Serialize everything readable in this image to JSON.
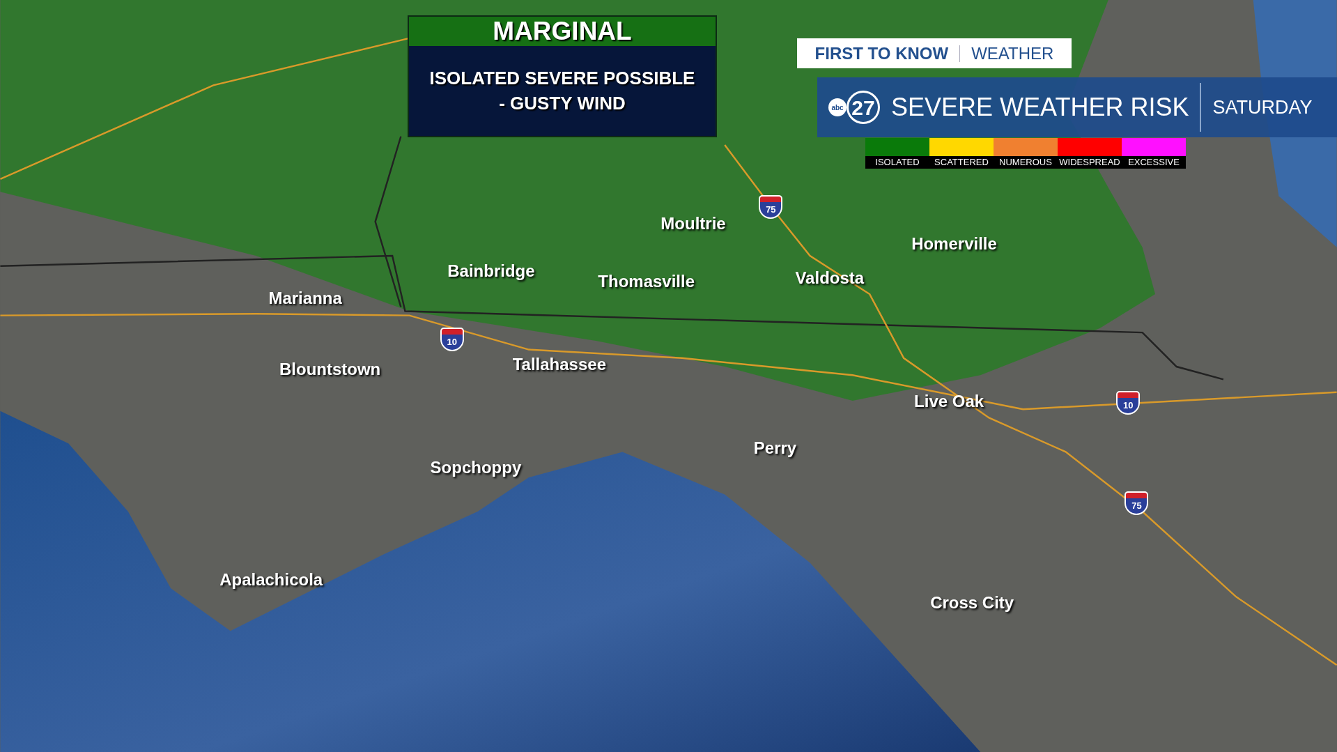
{
  "risk_box": {
    "category": "MARGINAL",
    "description": [
      "ISOLATED SEVERE POSSIBLE",
      "- GUSTY WIND"
    ]
  },
  "header": {
    "tag": [
      "FIRST TO KNOW",
      "WEATHER"
    ],
    "logo": {
      "network": "abc",
      "channel": "27"
    },
    "title": "SEVERE WEATHER RISK",
    "day": "SATURDAY"
  },
  "legend": [
    {
      "label": "ISOLATED",
      "color": "#0a7a0a"
    },
    {
      "label": "SCATTERED",
      "color": "#ffd800"
    },
    {
      "label": "NUMEROUS",
      "color": "#f08030"
    },
    {
      "label": "WIDESPREAD",
      "color": "#ff0000"
    },
    {
      "label": "EXCESSIVE",
      "color": "#ff10ff"
    }
  ],
  "cities": [
    {
      "name": "Moultrie"
    },
    {
      "name": "Homerville"
    },
    {
      "name": "Bainbridge"
    },
    {
      "name": "Thomasville"
    },
    {
      "name": "Valdosta"
    },
    {
      "name": "Marianna"
    },
    {
      "name": "Blountstown"
    },
    {
      "name": "Tallahassee"
    },
    {
      "name": "Live Oak"
    },
    {
      "name": "Perry"
    },
    {
      "name": "Sopchoppy"
    },
    {
      "name": "Apalachicola"
    },
    {
      "name": "Cross City"
    }
  ],
  "shields": [
    {
      "number": "75"
    },
    {
      "number": "10"
    },
    {
      "number": "10"
    },
    {
      "number": "75"
    }
  ]
}
